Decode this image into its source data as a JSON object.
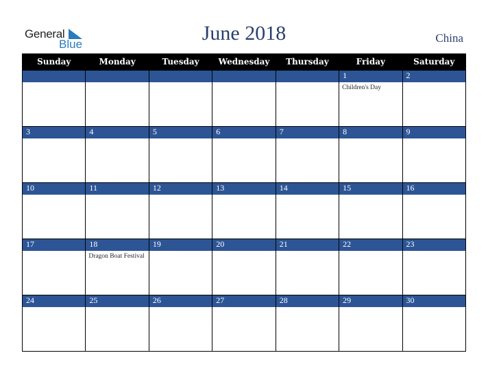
{
  "logo": {
    "text_general": "General",
    "text_blue": "Blue",
    "icon": "triangle-flag-icon",
    "brand_color": "#2a7abf"
  },
  "header": {
    "title": "June 2018",
    "country": "China"
  },
  "colors": {
    "header_bg": "#000000",
    "day_bar": "#2d5596",
    "title": "#2a3f6e"
  },
  "weekdays": [
    "Sunday",
    "Monday",
    "Tuesday",
    "Wednesday",
    "Thursday",
    "Friday",
    "Saturday"
  ],
  "weeks": [
    {
      "days": [
        "",
        "",
        "",
        "",
        "",
        "1",
        "2"
      ],
      "events": [
        "",
        "",
        "",
        "",
        "",
        "Children's Day",
        ""
      ]
    },
    {
      "days": [
        "3",
        "4",
        "5",
        "6",
        "7",
        "8",
        "9"
      ],
      "events": [
        "",
        "",
        "",
        "",
        "",
        "",
        ""
      ]
    },
    {
      "days": [
        "10",
        "11",
        "12",
        "13",
        "14",
        "15",
        "16"
      ],
      "events": [
        "",
        "",
        "",
        "",
        "",
        "",
        ""
      ]
    },
    {
      "days": [
        "17",
        "18",
        "19",
        "20",
        "21",
        "22",
        "23"
      ],
      "events": [
        "",
        "Dragon Boat Festival",
        "",
        "",
        "",
        "",
        ""
      ]
    },
    {
      "days": [
        "24",
        "25",
        "26",
        "27",
        "28",
        "29",
        "30"
      ],
      "events": [
        "",
        "",
        "",
        "",
        "",
        "",
        ""
      ]
    }
  ]
}
